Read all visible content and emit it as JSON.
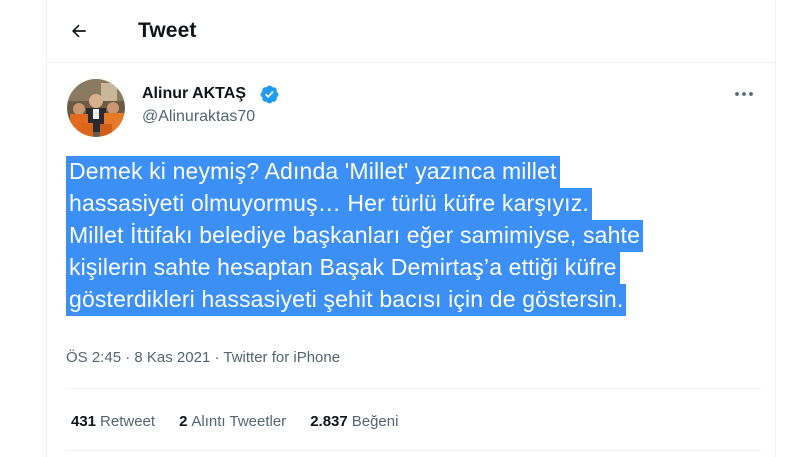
{
  "header": {
    "title": "Tweet",
    "back_icon": "arrow-left-icon"
  },
  "author": {
    "name": "Alinur AKTAŞ",
    "handle": "@Alinuraktas70",
    "verified": true,
    "verified_color": "#1d9bf0"
  },
  "tweet": {
    "lines": [
      "Demek ki neymiş? Adında 'Millet' yazınca millet",
      "hassasiyeti olmuyormuş… Her türlü küfre karşıyız.",
      "Millet İttifakı belediye başkanları eğer samimiyse, sahte",
      "kişilerin sahte hesaptan Başak Demirtaş’a ettiği küfre",
      "gösterdikleri hassasiyeti şehit bacısı için de göstersin."
    ],
    "selection_color": "#3b8ff5"
  },
  "meta": {
    "time": "ÖS 2:45",
    "sep1": " · ",
    "date": "8 Kas 2021",
    "sep2": " · ",
    "source": "Twitter for iPhone"
  },
  "stats": {
    "retweets_count": "431",
    "retweets_label": "Retweet",
    "quotes_count": "2",
    "quotes_label": "Alıntı Tweetler",
    "likes_count": "2.837",
    "likes_label": "Beğeni"
  },
  "more_icon": "ellipsis-icon"
}
